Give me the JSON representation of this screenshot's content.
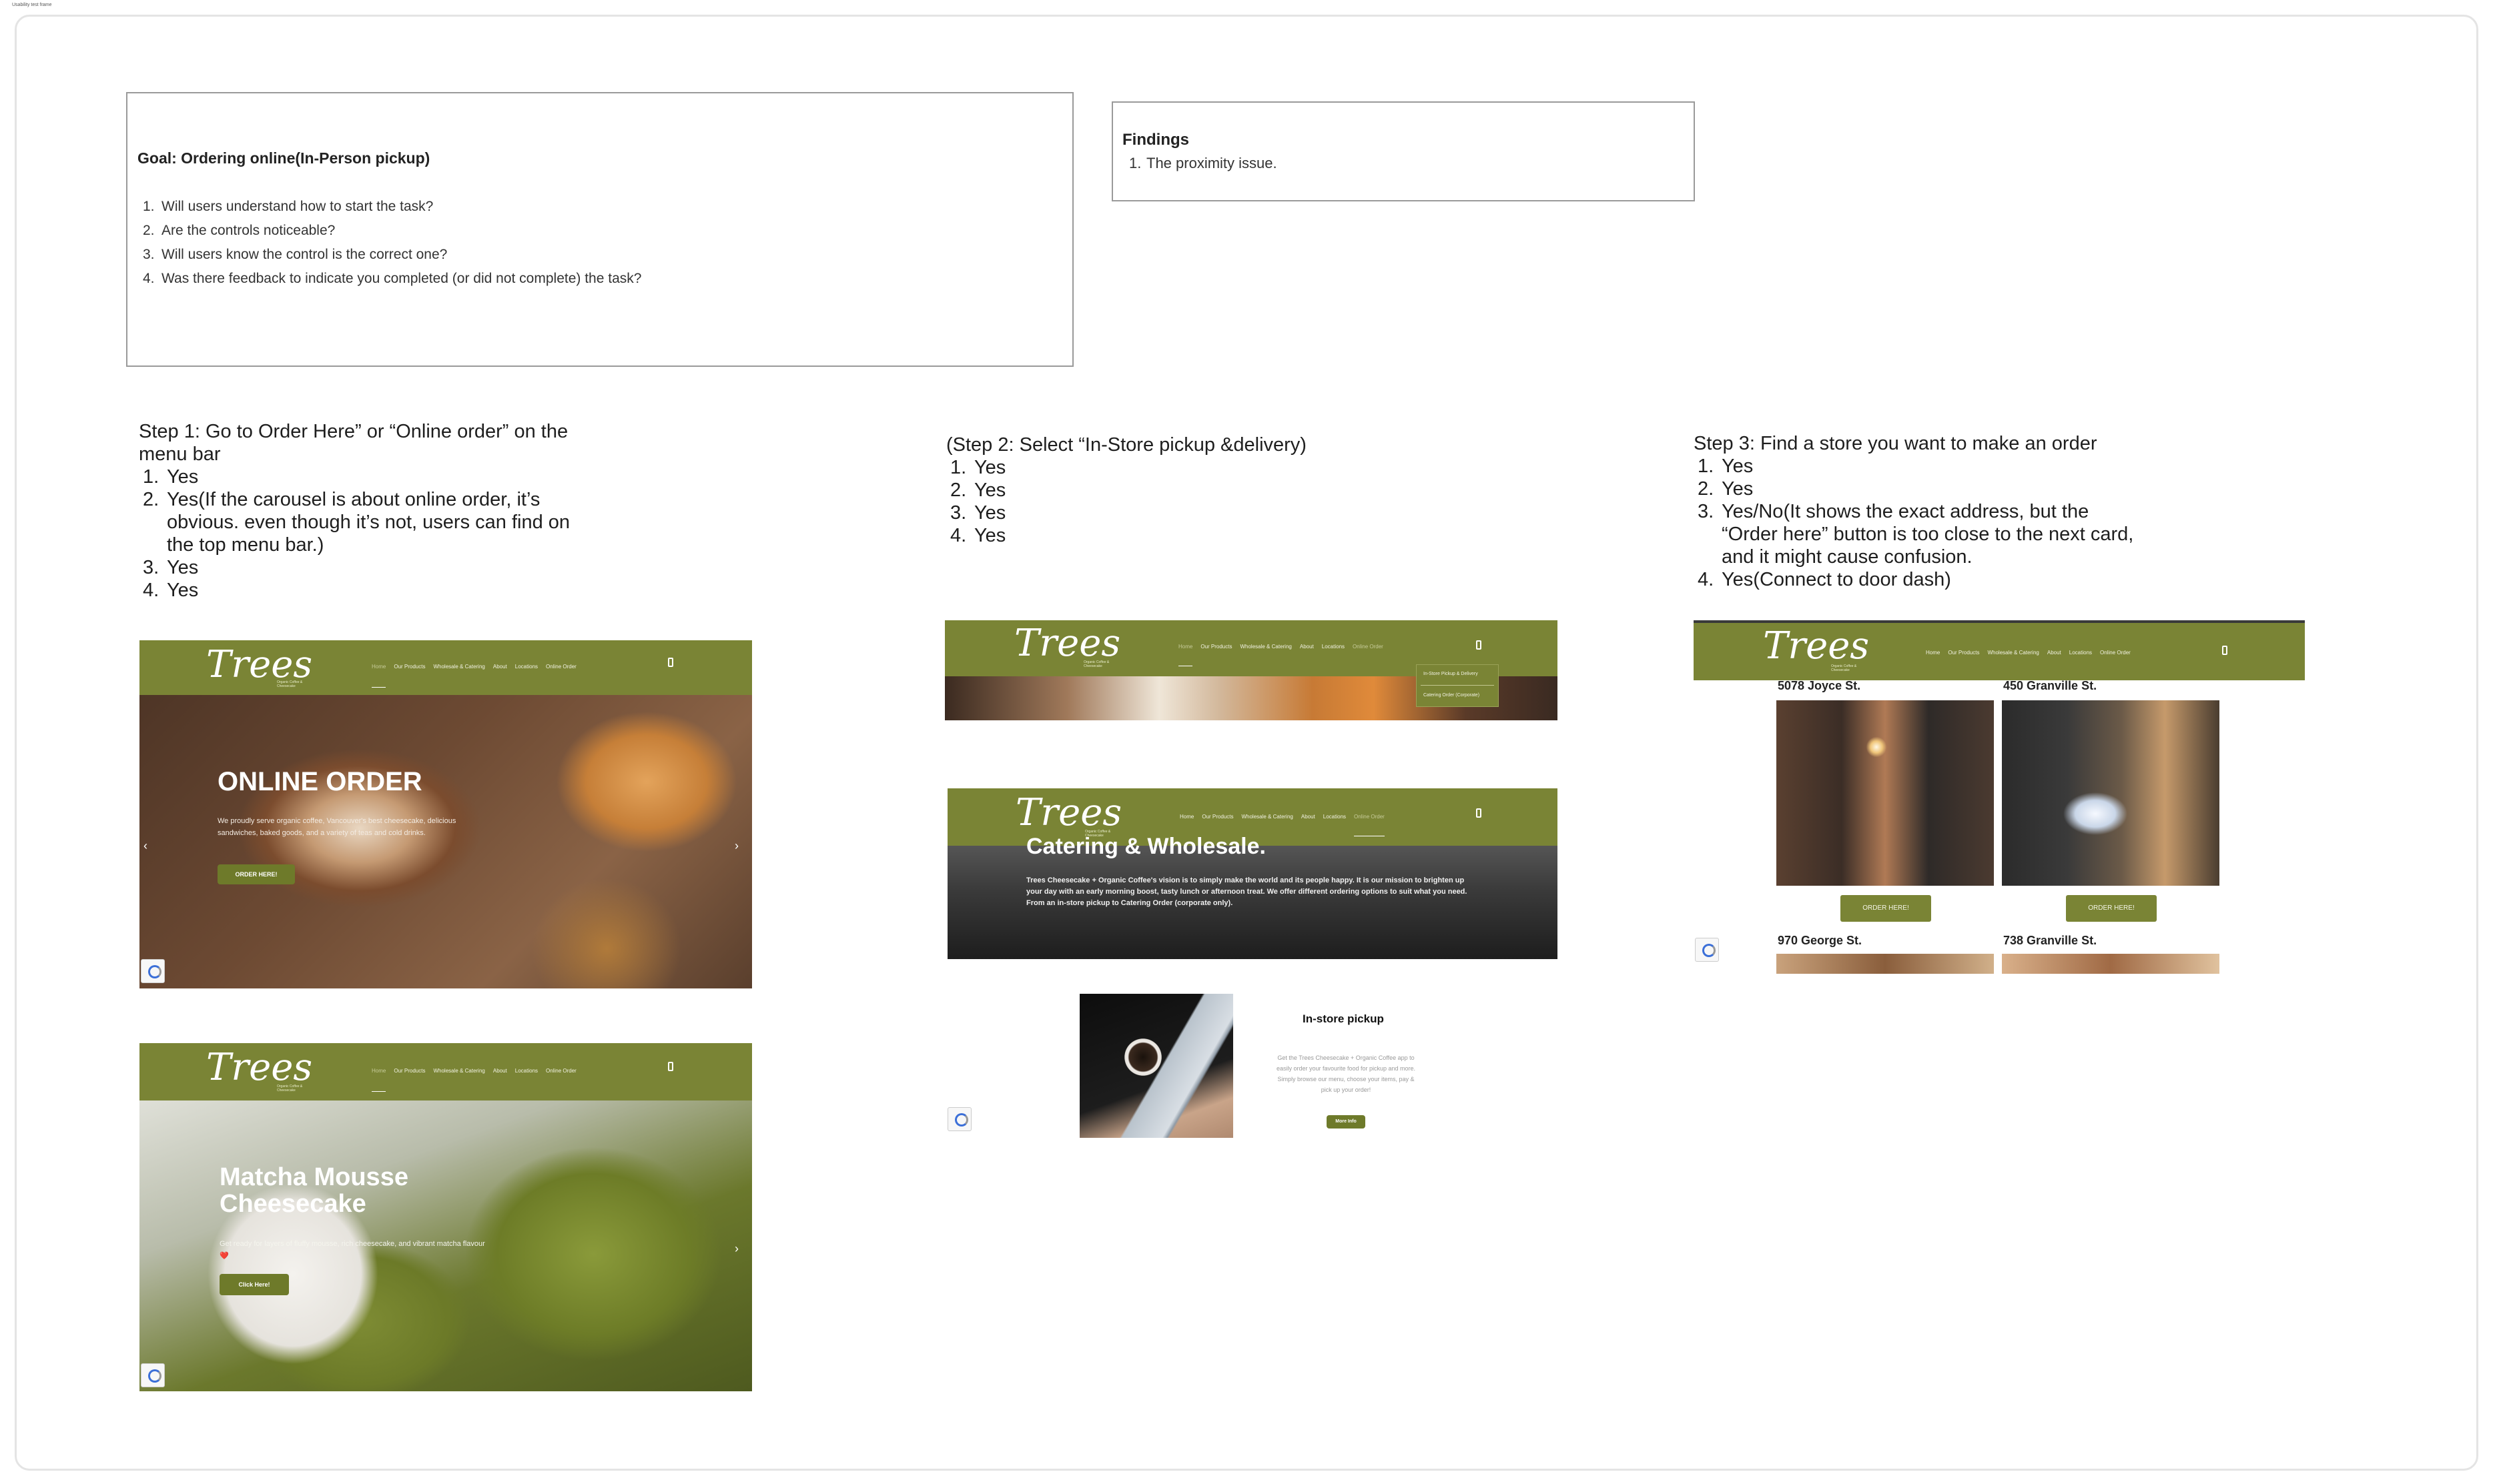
{
  "frame": {
    "label": "Usability test frame"
  },
  "goal": {
    "title": "Goal: Ordering online(In-Person pickup)",
    "questions": [
      "Will users understand how to start the task?",
      "Are the controls noticeable?",
      "Will users know the control is the correct one?",
      "Was there feedback to indicate you completed (or did not complete) the task?"
    ]
  },
  "findings": {
    "title": "Findings",
    "items": [
      "The proximity issue."
    ]
  },
  "steps": [
    {
      "heading_l1": "Step 1: Go to Order Here” or “Online order” on the",
      "heading_l2": "menu bar",
      "answers": [
        "Yes",
        "Yes(If the carousel is about online order, it’s",
        "Yes",
        "Yes"
      ],
      "answer2_cont": [
        "obvious. even though it’s not, users can find on",
        "the top menu bar.)"
      ]
    },
    {
      "heading_l1": "(Step 2: Select “In-Store pickup &delivery)",
      "answers": [
        "Yes",
        "Yes",
        "Yes",
        "Yes"
      ]
    },
    {
      "heading_l1": "Step 3: Find a store you want to make an order",
      "answers": [
        "Yes",
        "Yes",
        "Yes/No(It shows the exact address, but the",
        "Yes(Connect to door dash)"
      ],
      "answer3_cont": [
        "“Order here” button is too close to the next card,",
        "and it might cause confusion."
      ]
    }
  ],
  "site": {
    "logo": "Trees",
    "logo_sub": "Organic Coffee & Cheesecake",
    "nav": [
      "Home",
      "Our Products",
      "Wholesale & Catering",
      "About",
      "Locations",
      "Online Order"
    ],
    "hero1": {
      "title": "ONLINE ORDER",
      "text": "We proudly serve organic coffee, Vancouver's best cheesecake, delicious sandwiches, baked goods, and a variety of teas and cold drinks.",
      "button": "ORDER HERE!"
    },
    "hero2": {
      "title_l1": "Matcha Mousse",
      "title_l2": "Cheesecake",
      "text": "Get ready for layers of fluffy mousse, rich cheesecake, and vibrant matcha flavour ❤️",
      "button": "Click Here!"
    },
    "dropdown": [
      "In-Store Pickup & Delivery",
      "Catering Order (Corporate)"
    ],
    "catering": {
      "title": "Catering & Wholesale.",
      "text": "Trees Cheesecake + Organic Coffee's vision is to simply make the world and its people happy. It is our mission to brighten up your day with an early morning boost, tasty lunch or afternoon treat. We offer different ordering options to suit what you need. From an in-store pickup to Catering Order (corporate only)."
    },
    "pickup": {
      "title": "In-store pickup",
      "text": "Get the Trees Cheesecake + Organic Coffee app to easily order your favourite food for pickup and more. Simply browse our menu, choose your items, pay & pick up your order!",
      "button": "More Info"
    },
    "stores": [
      "5078 Joyce St.",
      "450 Granville St.",
      "970 George St.",
      "738 Granville St."
    ],
    "order_button": "ORDER HERE!"
  },
  "colors": {
    "brand_green": "#7a8435",
    "button_green": "#6e7a2a"
  }
}
